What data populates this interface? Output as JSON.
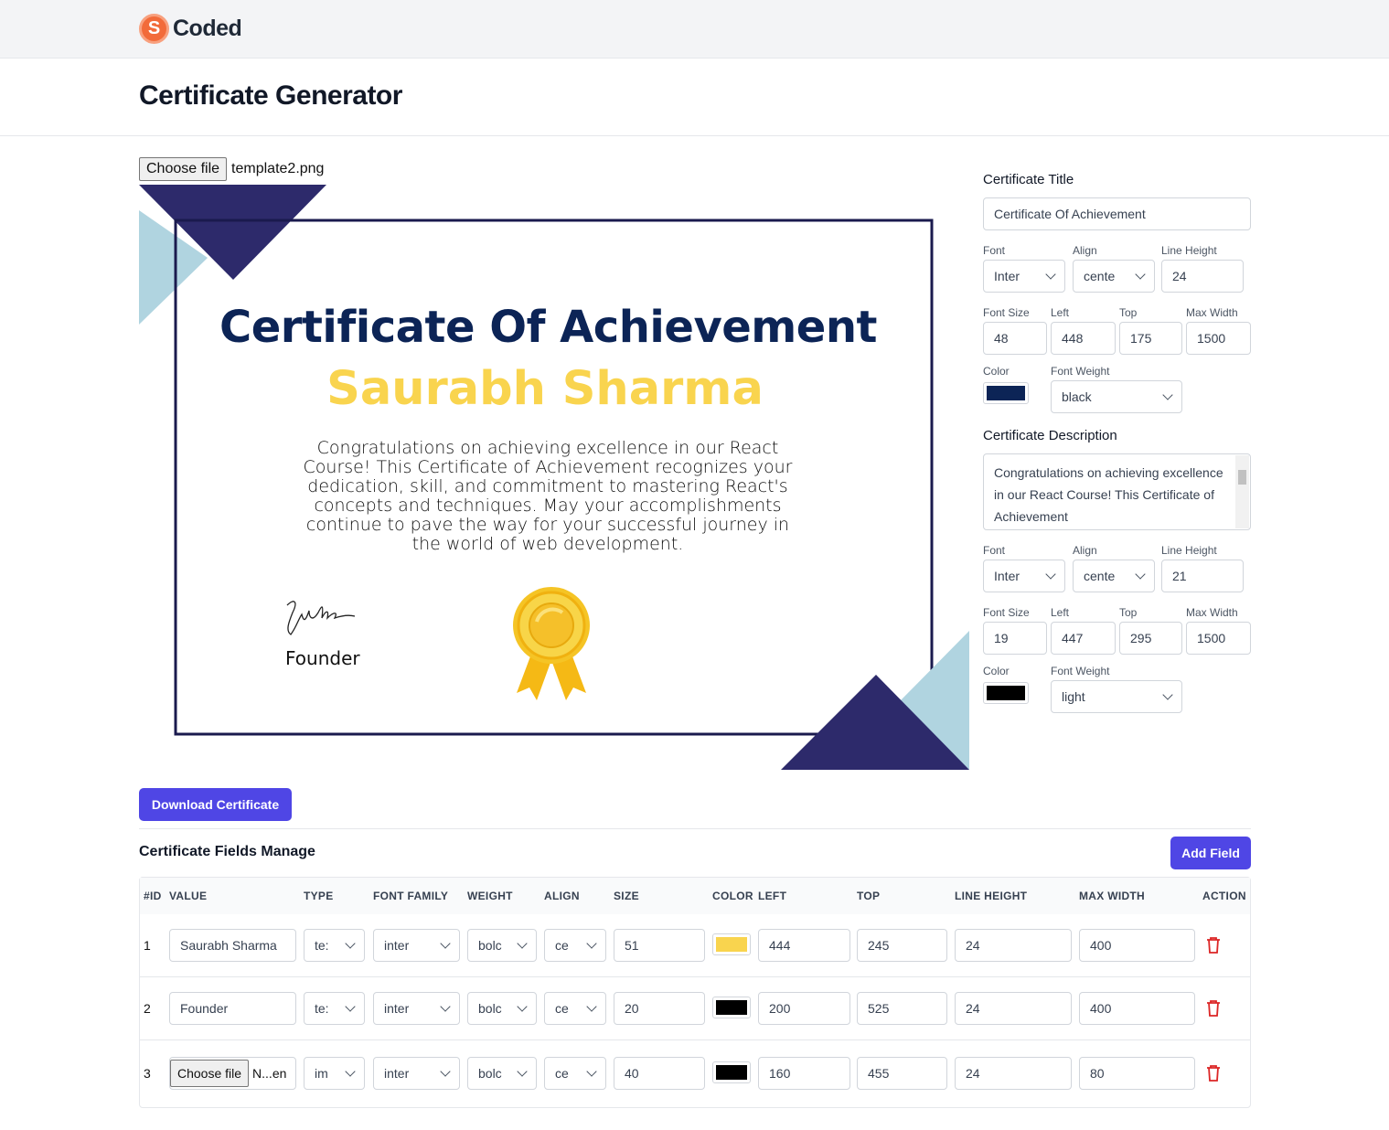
{
  "brand": {
    "name": "Coded",
    "logo_letter": "S"
  },
  "page": {
    "title": "Certificate Generator"
  },
  "upload": {
    "button_label": "Choose file",
    "file_name": "template2.png"
  },
  "certificate_preview": {
    "title": "Certificate Of Achievement",
    "name": "Saurabh Sharma",
    "description": "Congratulations on achieving excellence in our React Course! This Certificate of Achievement recognizes your dedication, skill, and commitment to mastering React's concepts and techniques. May your accomplishments continue to pave the way for your successful journey in the world of web development.",
    "founder_label": "Founder",
    "colors": {
      "title": "#0c2456",
      "name": "#f9d44e",
      "frame": "#1a1a4e",
      "triangle_dark": "#2d2a6b",
      "triangle_light": "#b0d4e0"
    }
  },
  "title_settings": {
    "section_label": "Certificate Title",
    "value": "Certificate Of Achievement",
    "labels": {
      "font": "Font",
      "align": "Align",
      "line_height": "Line Height",
      "font_size": "Font Size",
      "left": "Left",
      "top": "Top",
      "max_width": "Max Width",
      "color": "Color",
      "font_weight": "Font Weight"
    },
    "font": "Inter",
    "align": "cente",
    "line_height": "24",
    "font_size": "48",
    "left": "448",
    "top": "175",
    "max_width": "1500",
    "color": "#0c2456",
    "font_weight": "black"
  },
  "description_settings": {
    "section_label": "Certificate Description",
    "value": "Congratulations on achieving excellence in our React Course! This Certificate of Achievement",
    "labels": {
      "font": "Font",
      "align": "Align",
      "line_height": "Line Height",
      "font_size": "Font Size",
      "left": "Left",
      "top": "Top",
      "max_width": "Max Width",
      "color": "Color",
      "font_weight": "Font Weight"
    },
    "font": "Inter",
    "align": "cente",
    "line_height": "21",
    "font_size": "19",
    "left": "447",
    "top": "295",
    "max_width": "1500",
    "color": "#000000",
    "font_weight": "light"
  },
  "actions": {
    "download": "Download Certificate",
    "add_field": "Add Field"
  },
  "fields": {
    "title": "Certificate Fields Manage",
    "columns": [
      "#ID",
      "VALUE",
      "TYPE",
      "FONT FAMILY",
      "WEIGHT",
      "ALIGN",
      "SIZE",
      "COLOR",
      "LEFT",
      "TOP",
      "LINE HEIGHT",
      "MAX WIDTH",
      "ACTION"
    ],
    "rows": [
      {
        "id": "1",
        "value": "Saurabh Sharma",
        "type": "te:",
        "font": "inter",
        "weight": "bolc",
        "align": "ce",
        "size": "51",
        "color": "#f9d44e",
        "left": "444",
        "top": "245",
        "line_height": "24",
        "max_width": "400"
      },
      {
        "id": "2",
        "value": "Founder",
        "type": "te:",
        "font": "inter",
        "weight": "bolc",
        "align": "ce",
        "size": "20",
        "color": "#000000",
        "left": "200",
        "top": "525",
        "line_height": "24",
        "max_width": "400"
      },
      {
        "id": "3",
        "value_button": "Choose file",
        "value_file": "N...en",
        "type": "im",
        "font": "inter",
        "weight": "bolc",
        "align": "ce",
        "size": "40",
        "color": "#000000",
        "left": "160",
        "top": "455",
        "line_height": "24",
        "max_width": "80"
      }
    ]
  }
}
